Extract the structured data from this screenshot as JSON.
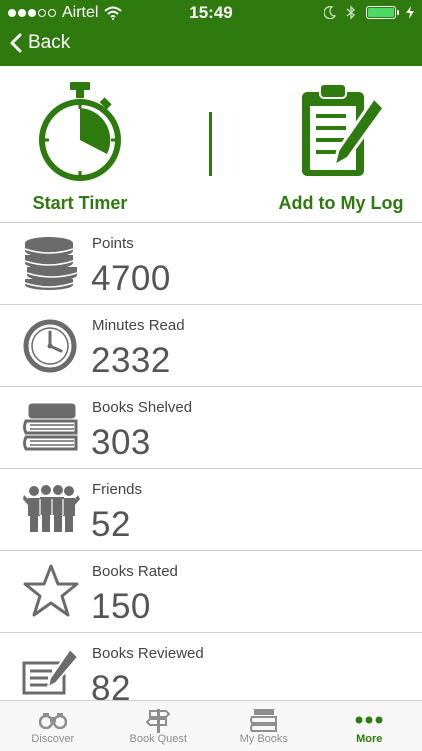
{
  "status_bar": {
    "carrier": "Airtel",
    "time": "15:49"
  },
  "nav": {
    "back_label": "Back"
  },
  "actions": {
    "timer_label": "Start Timer",
    "log_label": "Add to My Log",
    "accent_color": "#2f7a0e"
  },
  "stats": [
    {
      "label": "Points",
      "value": "4700",
      "icon": "coins-icon"
    },
    {
      "label": "Minutes Read",
      "value": "2332",
      "icon": "clock-icon"
    },
    {
      "label": "Books Shelved",
      "value": "303",
      "icon": "book-stack-icon"
    },
    {
      "label": "Friends",
      "value": "52",
      "icon": "friends-icon"
    },
    {
      "label": "Books Rated",
      "value": "150",
      "icon": "star-icon"
    },
    {
      "label": "Books Reviewed",
      "value": "82",
      "icon": "review-pen-icon"
    }
  ],
  "tabs": [
    {
      "label": "Discover",
      "icon": "binoculars-icon"
    },
    {
      "label": "Book Quest",
      "icon": "signpost-icon"
    },
    {
      "label": "My Books",
      "icon": "books-icon"
    },
    {
      "label": "More",
      "icon": "more-dots-icon",
      "active": true
    }
  ]
}
